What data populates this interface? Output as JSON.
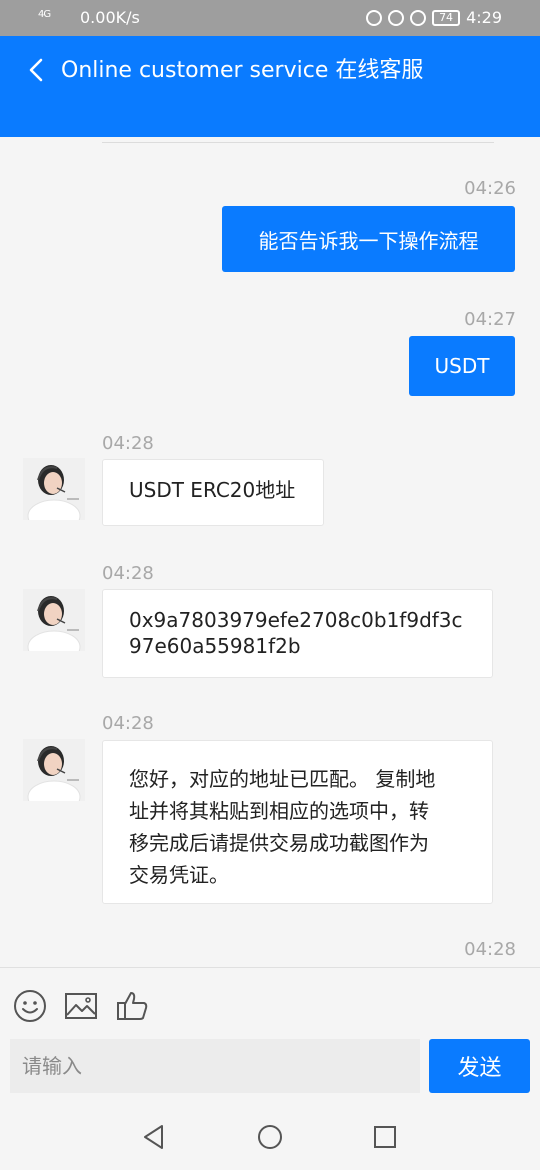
{
  "status_bar": {
    "signal": "4G",
    "network_speed": "0.00K/s",
    "battery": "74",
    "time": "4:29"
  },
  "header": {
    "title": "Online customer service 在线客服"
  },
  "messages": [
    {
      "time": "04:26",
      "direction": "out",
      "text": "能否告诉我一下操作流程"
    },
    {
      "time": "04:27",
      "direction": "out",
      "text": "USDT"
    },
    {
      "time": "04:28",
      "direction": "in",
      "text": "USDT ERC20地址"
    },
    {
      "time": "04:28",
      "direction": "in",
      "lines": [
        "0x9a7803979efe2708c0b1f9df3c",
        "97e60a55981f2b"
      ]
    },
    {
      "time": "04:28",
      "direction": "in",
      "lines": [
        "您好，对应的地址已匹配。 复制地",
        "址并将其粘贴到相应的选项中，转",
        "移完成后请提供交易成功截图作为",
        "交易凭证。"
      ]
    },
    {
      "time": "04:28"
    }
  ],
  "input": {
    "placeholder": "请输入",
    "value": "",
    "send_label": "发送"
  },
  "icons": {
    "emoji": "emoji-icon",
    "image": "image-icon",
    "like": "thumbs-up-icon",
    "back": "back-arrow-icon",
    "nav_back": "nav-back-icon",
    "nav_home": "nav-home-icon",
    "nav_recents": "nav-recents-icon"
  },
  "colors": {
    "accent": "#0a7bff",
    "background": "#f5f5f5",
    "timestamp": "#a8a8a8"
  }
}
